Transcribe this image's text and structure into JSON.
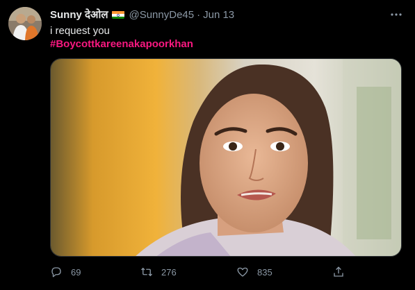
{
  "tweet": {
    "display_name": "Sunny देओल",
    "handle": "@SunnyDe45",
    "separator": "·",
    "date": "Jun 13",
    "text": "i request you",
    "hashtag": "#Boycottkareenakapoorkhan"
  },
  "icons": {
    "more": "more-dots-icon",
    "reply": "reply-icon",
    "retweet": "retweet-icon",
    "like": "heart-icon",
    "share": "share-icon",
    "flag": "india-flag-icon"
  },
  "stats": {
    "replies": "69",
    "retweets": "276",
    "likes": "835"
  },
  "colors": {
    "background": "#000000",
    "text": "#e7e9ea",
    "muted": "#8b98a5",
    "hashtag": "#f91880"
  }
}
